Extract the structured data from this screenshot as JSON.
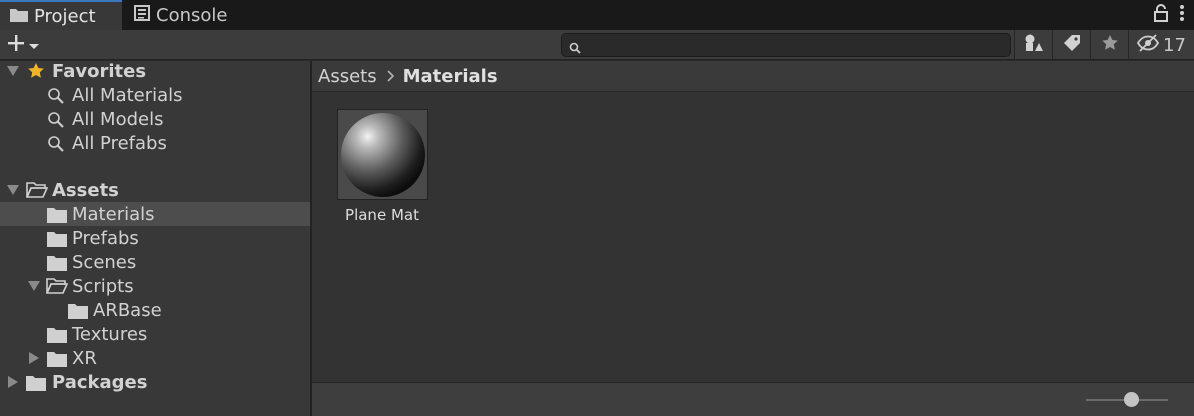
{
  "tabs": [
    {
      "label": "Project",
      "icon": "folder-icon",
      "active": true
    },
    {
      "label": "Console",
      "icon": "console-icon",
      "active": false
    }
  ],
  "toolbar": {
    "search_value": "",
    "hidden_count": "17"
  },
  "tree": {
    "favorites": {
      "label": "Favorites",
      "items": [
        "All Materials",
        "All Models",
        "All Prefabs"
      ]
    },
    "assets": {
      "label": "Assets",
      "items": [
        {
          "label": "Materials",
          "selected": true
        },
        {
          "label": "Prefabs"
        },
        {
          "label": "Scenes"
        },
        {
          "label": "Scripts",
          "expanded": true
        },
        {
          "label": "ARBase"
        },
        {
          "label": "Textures"
        },
        {
          "label": "XR",
          "expanded": false
        }
      ]
    },
    "packages": {
      "label": "Packages"
    }
  },
  "breadcrumb": {
    "root": "Assets",
    "current": "Materials"
  },
  "assets": [
    {
      "name": "Plane Mat",
      "type": "material-sphere"
    }
  ],
  "zoom_level": 0.55,
  "colors": {
    "accent": "#3a79bb",
    "favorite_star": "#f0b429",
    "selected_row": "#4d4d4d"
  }
}
